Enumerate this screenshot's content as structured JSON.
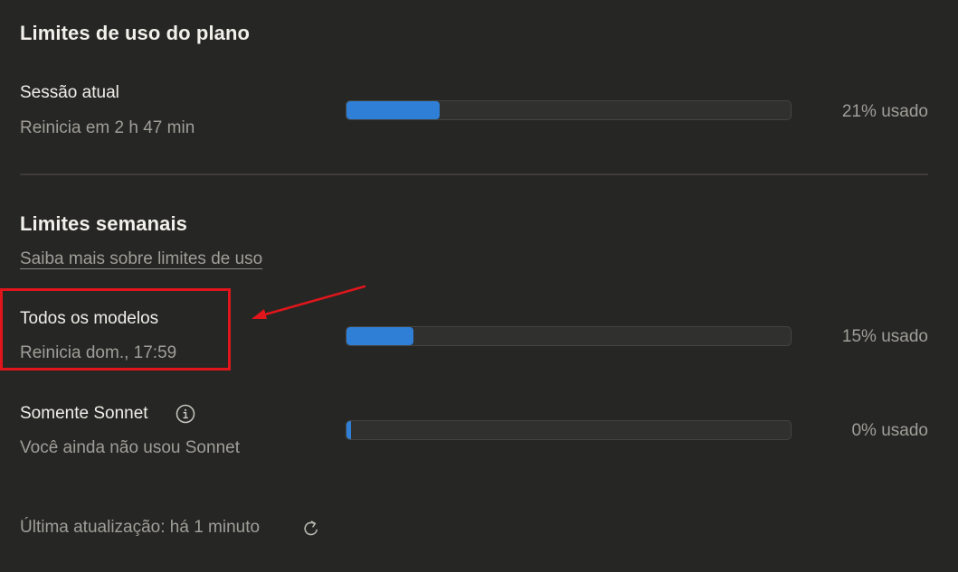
{
  "plan_limits": {
    "title": "Limites de uso do plano",
    "current_session": {
      "label": "Sessão atual",
      "reset": "Reinicia em 2 h 47 min",
      "usage_text": "21% usado",
      "usage_fraction": 0.21
    }
  },
  "weekly_limits": {
    "title": "Limites semanais",
    "learn_more": "Saiba mais sobre limites de uso",
    "all_models": {
      "label": "Todos os modelos",
      "reset": "Reinicia dom., 17:59",
      "usage_text": "15% usado",
      "usage_fraction": 0.15
    },
    "sonnet_only": {
      "label": "Somente Sonnet",
      "reset": "Você ainda não usou Sonnet",
      "usage_text": "0% usado",
      "usage_fraction": 0.0
    }
  },
  "footer": {
    "last_updated": "Última atualização: há 1 minuto"
  },
  "icons": {
    "info": "info-icon",
    "refresh": "refresh-icon"
  },
  "colors": {
    "background": "#262624",
    "bar_fill": "#2f7fd6",
    "bar_track": "#30302e",
    "highlight": "#e0161c"
  }
}
